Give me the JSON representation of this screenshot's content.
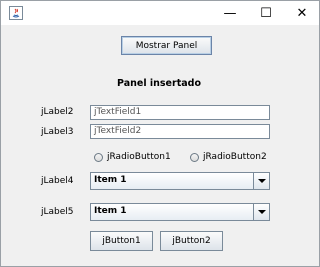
{
  "window": {
    "icon": "java-icon",
    "controls": {
      "minimize": "—",
      "maximize": "☐",
      "close": "✕"
    }
  },
  "main": {
    "show_panel_button": "Mostrar Panel",
    "panel_title": "Panel insertado",
    "label2": "jLabel2",
    "textfield1": "jTextField1",
    "label3": "jLabel3",
    "textfield2": "jTextField2",
    "radio1": "jRadioButton1",
    "radio2": "jRadioButton2",
    "label4": "jLabel4",
    "combo1_value": "Item 1",
    "label5": "jLabel5",
    "combo2_value": "Item 1",
    "button1": "jButton1",
    "button2": "jButton2"
  }
}
